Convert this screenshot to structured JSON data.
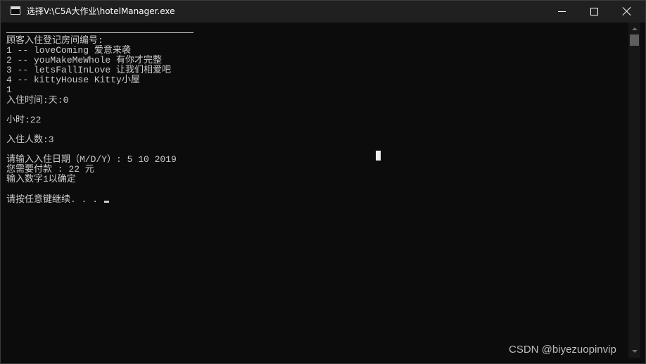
{
  "window": {
    "title": "选择V:\\C5A大作业\\hotelManager.exe",
    "icon": "console-window-icon"
  },
  "controls": {
    "minimize": "minimize-icon",
    "maximize": "maximize-icon",
    "close": "close-icon"
  },
  "console": {
    "lines": [
      "顾客入住登记房间编号:",
      "1 -- loveComing 爱意来袭",
      "2 -- youMakeMeWhole 有你才完整",
      "3 -- letsFallInLove 让我们相爱吧",
      "4 -- kittyHouse Kitty小屋",
      "1",
      "入住时间:天:0",
      "",
      "小时:22",
      "",
      "入住人数:3",
      "",
      "请输入入住日期（M/D/Y）: 5 10 2019",
      "您需要付款 : 22 元",
      "输入数字1以确定",
      "",
      "请按任意键继续. . . "
    ]
  },
  "watermark": "CSDN @biyezuopinvip",
  "colors": {
    "background": "#0c0c0c",
    "text": "#cccccc",
    "titlebar": "#202020"
  }
}
